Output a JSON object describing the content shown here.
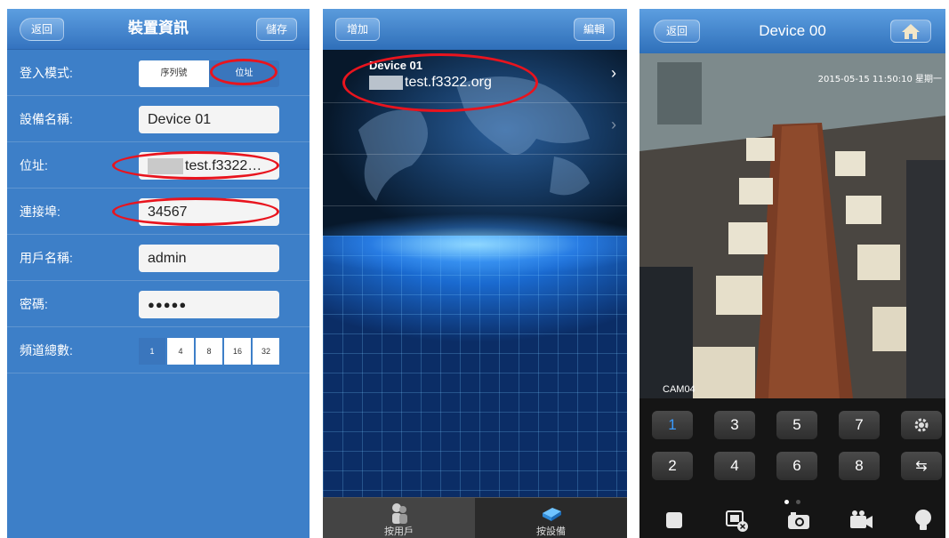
{
  "screen1": {
    "back": "返回",
    "title": "裝置資訊",
    "save": "儲存",
    "login_mode": {
      "label": "登入模式:",
      "options": [
        "序列號",
        "位址"
      ],
      "selected": "位址"
    },
    "device_name": {
      "label": "設備名稱:",
      "value": "Device 01"
    },
    "address": {
      "label": "位址:",
      "value": "test.f3322…"
    },
    "port": {
      "label": "連接埠:",
      "value": "34567"
    },
    "username": {
      "label": "用戶名稱:",
      "value": "admin"
    },
    "password": {
      "label": "密碼:",
      "value": "●●●●●"
    },
    "channels": {
      "label": "頻道總數:",
      "options": [
        "1",
        "4",
        "8",
        "16",
        "32"
      ],
      "selected": "1"
    }
  },
  "screen2": {
    "add": "增加",
    "edit": "編輯",
    "device": {
      "name": "Device 01",
      "address": "test.f3322.org"
    },
    "tabs": [
      {
        "label": "按用戶",
        "icon": "users-icon"
      },
      {
        "label": "按設備",
        "icon": "device-icon"
      }
    ]
  },
  "screen3": {
    "back": "返回",
    "title": "Device 00",
    "timestamp": "2015-05-15 11:50:10 星期一",
    "camera_label": "CAM04",
    "keys_row1": [
      "1",
      "3",
      "5",
      "7"
    ],
    "keys_row2": [
      "2",
      "4",
      "6",
      "8"
    ],
    "active_key": "1",
    "toolbar": [
      "stop-icon",
      "close-video-icon",
      "snapshot-icon",
      "record-icon",
      "light-icon"
    ]
  },
  "colors": {
    "accent": "#3d7fc8",
    "highlight_ring": "#e8141e",
    "active_channel": "#3a9bff"
  }
}
